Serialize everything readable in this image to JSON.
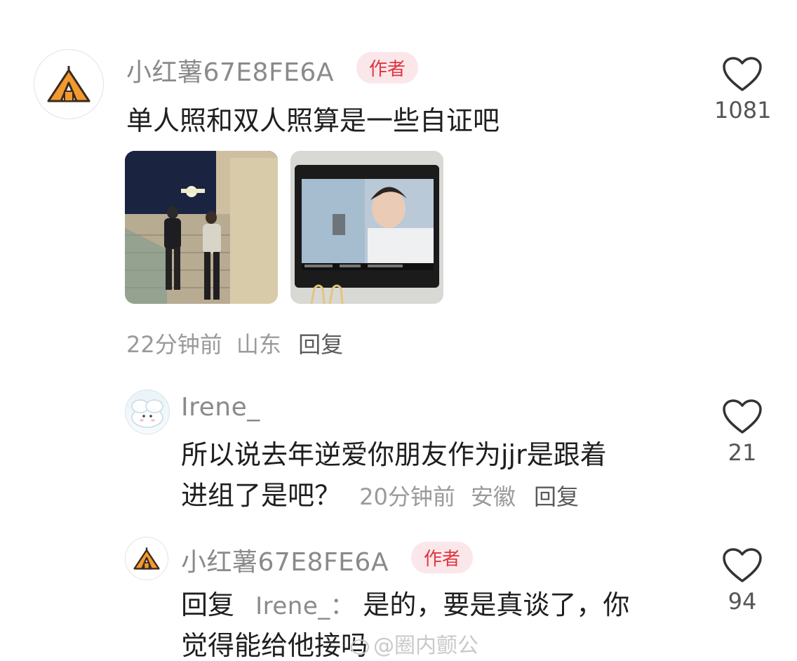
{
  "comments": [
    {
      "username": "小红薯67E8FE6A",
      "badge": "作者",
      "text": "单人照和双人照算是一些自证吧",
      "time": "22分钟前",
      "location": "山东",
      "reply_label": "回复",
      "likes": "1081",
      "avatar_icon": "tent-icon",
      "images": [
        "photo-stairs",
        "photo-monitor"
      ]
    },
    {
      "username": "Irene_",
      "text_line1": "所以说去年逆爱你朋友作为jjr是跟着",
      "text_line2": "进组了是吧？",
      "time": "20分钟前",
      "location": "安徽",
      "reply_label": "回复",
      "likes": "21",
      "avatar_icon": "cartoon-avatar-icon"
    },
    {
      "username": "小红薯67E8FE6A",
      "badge": "作者",
      "reply_prefix": "回复",
      "reply_to": "Irene_：",
      "text_line1": "是的，要是真谈了，你",
      "text_line2": "觉得能给他接吗",
      "likes": "94",
      "avatar_icon": "tent-icon"
    }
  ],
  "watermark": "@圈内颤公",
  "colors": {
    "badge_bg": "#fbe7ea",
    "badge_text": "#e0353f",
    "username": "#8a8a8a",
    "meta": "#9a9a9a",
    "tent_orange": "#f29a2e"
  }
}
